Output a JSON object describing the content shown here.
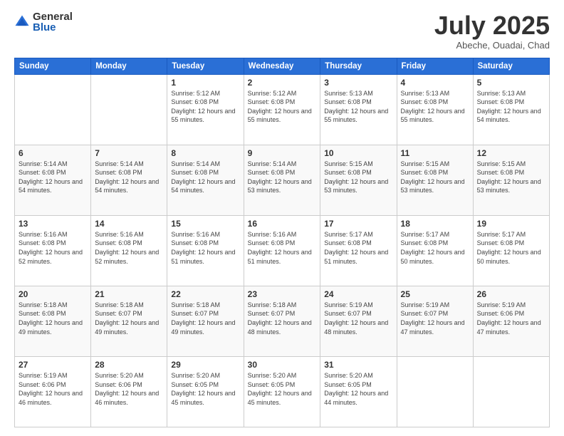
{
  "logo": {
    "general": "General",
    "blue": "Blue"
  },
  "title": "July 2025",
  "subtitle": "Abeche, Ouadai, Chad",
  "weekdays": [
    "Sunday",
    "Monday",
    "Tuesday",
    "Wednesday",
    "Thursday",
    "Friday",
    "Saturday"
  ],
  "weeks": [
    [
      {
        "day": "",
        "sunrise": "",
        "sunset": "",
        "daylight": ""
      },
      {
        "day": "",
        "sunrise": "",
        "sunset": "",
        "daylight": ""
      },
      {
        "day": "1",
        "sunrise": "Sunrise: 5:12 AM",
        "sunset": "Sunset: 6:08 PM",
        "daylight": "Daylight: 12 hours and 55 minutes."
      },
      {
        "day": "2",
        "sunrise": "Sunrise: 5:12 AM",
        "sunset": "Sunset: 6:08 PM",
        "daylight": "Daylight: 12 hours and 55 minutes."
      },
      {
        "day": "3",
        "sunrise": "Sunrise: 5:13 AM",
        "sunset": "Sunset: 6:08 PM",
        "daylight": "Daylight: 12 hours and 55 minutes."
      },
      {
        "day": "4",
        "sunrise": "Sunrise: 5:13 AM",
        "sunset": "Sunset: 6:08 PM",
        "daylight": "Daylight: 12 hours and 55 minutes."
      },
      {
        "day": "5",
        "sunrise": "Sunrise: 5:13 AM",
        "sunset": "Sunset: 6:08 PM",
        "daylight": "Daylight: 12 hours and 54 minutes."
      }
    ],
    [
      {
        "day": "6",
        "sunrise": "Sunrise: 5:14 AM",
        "sunset": "Sunset: 6:08 PM",
        "daylight": "Daylight: 12 hours and 54 minutes."
      },
      {
        "day": "7",
        "sunrise": "Sunrise: 5:14 AM",
        "sunset": "Sunset: 6:08 PM",
        "daylight": "Daylight: 12 hours and 54 minutes."
      },
      {
        "day": "8",
        "sunrise": "Sunrise: 5:14 AM",
        "sunset": "Sunset: 6:08 PM",
        "daylight": "Daylight: 12 hours and 54 minutes."
      },
      {
        "day": "9",
        "sunrise": "Sunrise: 5:14 AM",
        "sunset": "Sunset: 6:08 PM",
        "daylight": "Daylight: 12 hours and 53 minutes."
      },
      {
        "day": "10",
        "sunrise": "Sunrise: 5:15 AM",
        "sunset": "Sunset: 6:08 PM",
        "daylight": "Daylight: 12 hours and 53 minutes."
      },
      {
        "day": "11",
        "sunrise": "Sunrise: 5:15 AM",
        "sunset": "Sunset: 6:08 PM",
        "daylight": "Daylight: 12 hours and 53 minutes."
      },
      {
        "day": "12",
        "sunrise": "Sunrise: 5:15 AM",
        "sunset": "Sunset: 6:08 PM",
        "daylight": "Daylight: 12 hours and 53 minutes."
      }
    ],
    [
      {
        "day": "13",
        "sunrise": "Sunrise: 5:16 AM",
        "sunset": "Sunset: 6:08 PM",
        "daylight": "Daylight: 12 hours and 52 minutes."
      },
      {
        "day": "14",
        "sunrise": "Sunrise: 5:16 AM",
        "sunset": "Sunset: 6:08 PM",
        "daylight": "Daylight: 12 hours and 52 minutes."
      },
      {
        "day": "15",
        "sunrise": "Sunrise: 5:16 AM",
        "sunset": "Sunset: 6:08 PM",
        "daylight": "Daylight: 12 hours and 51 minutes."
      },
      {
        "day": "16",
        "sunrise": "Sunrise: 5:16 AM",
        "sunset": "Sunset: 6:08 PM",
        "daylight": "Daylight: 12 hours and 51 minutes."
      },
      {
        "day": "17",
        "sunrise": "Sunrise: 5:17 AM",
        "sunset": "Sunset: 6:08 PM",
        "daylight": "Daylight: 12 hours and 51 minutes."
      },
      {
        "day": "18",
        "sunrise": "Sunrise: 5:17 AM",
        "sunset": "Sunset: 6:08 PM",
        "daylight": "Daylight: 12 hours and 50 minutes."
      },
      {
        "day": "19",
        "sunrise": "Sunrise: 5:17 AM",
        "sunset": "Sunset: 6:08 PM",
        "daylight": "Daylight: 12 hours and 50 minutes."
      }
    ],
    [
      {
        "day": "20",
        "sunrise": "Sunrise: 5:18 AM",
        "sunset": "Sunset: 6:08 PM",
        "daylight": "Daylight: 12 hours and 49 minutes."
      },
      {
        "day": "21",
        "sunrise": "Sunrise: 5:18 AM",
        "sunset": "Sunset: 6:07 PM",
        "daylight": "Daylight: 12 hours and 49 minutes."
      },
      {
        "day": "22",
        "sunrise": "Sunrise: 5:18 AM",
        "sunset": "Sunset: 6:07 PM",
        "daylight": "Daylight: 12 hours and 49 minutes."
      },
      {
        "day": "23",
        "sunrise": "Sunrise: 5:18 AM",
        "sunset": "Sunset: 6:07 PM",
        "daylight": "Daylight: 12 hours and 48 minutes."
      },
      {
        "day": "24",
        "sunrise": "Sunrise: 5:19 AM",
        "sunset": "Sunset: 6:07 PM",
        "daylight": "Daylight: 12 hours and 48 minutes."
      },
      {
        "day": "25",
        "sunrise": "Sunrise: 5:19 AM",
        "sunset": "Sunset: 6:07 PM",
        "daylight": "Daylight: 12 hours and 47 minutes."
      },
      {
        "day": "26",
        "sunrise": "Sunrise: 5:19 AM",
        "sunset": "Sunset: 6:06 PM",
        "daylight": "Daylight: 12 hours and 47 minutes."
      }
    ],
    [
      {
        "day": "27",
        "sunrise": "Sunrise: 5:19 AM",
        "sunset": "Sunset: 6:06 PM",
        "daylight": "Daylight: 12 hours and 46 minutes."
      },
      {
        "day": "28",
        "sunrise": "Sunrise: 5:20 AM",
        "sunset": "Sunset: 6:06 PM",
        "daylight": "Daylight: 12 hours and 46 minutes."
      },
      {
        "day": "29",
        "sunrise": "Sunrise: 5:20 AM",
        "sunset": "Sunset: 6:05 PM",
        "daylight": "Daylight: 12 hours and 45 minutes."
      },
      {
        "day": "30",
        "sunrise": "Sunrise: 5:20 AM",
        "sunset": "Sunset: 6:05 PM",
        "daylight": "Daylight: 12 hours and 45 minutes."
      },
      {
        "day": "31",
        "sunrise": "Sunrise: 5:20 AM",
        "sunset": "Sunset: 6:05 PM",
        "daylight": "Daylight: 12 hours and 44 minutes."
      },
      {
        "day": "",
        "sunrise": "",
        "sunset": "",
        "daylight": ""
      },
      {
        "day": "",
        "sunrise": "",
        "sunset": "",
        "daylight": ""
      }
    ]
  ]
}
